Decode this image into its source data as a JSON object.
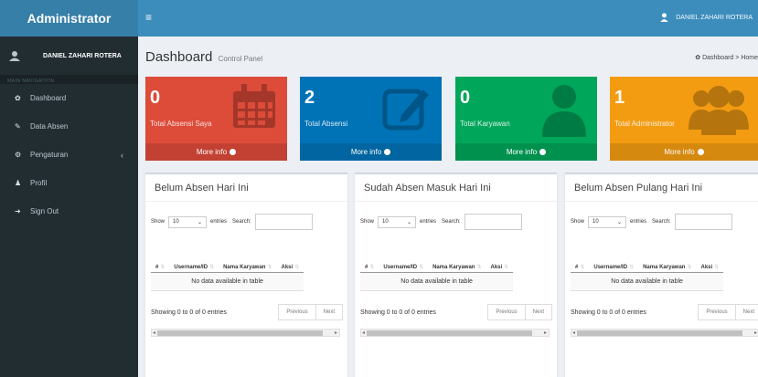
{
  "header": {
    "logo": "Administrator",
    "toggle_icon": "≡",
    "user_name": "DANIEL ZAHARI ROTERA"
  },
  "sidebar": {
    "user_name": "DANIEL ZAHARI ROTERA",
    "nav_header": "MAIN NAVIGATION",
    "items": [
      {
        "label": "Dashboard",
        "icon": "dashboard-icon",
        "glyph": "✿"
      },
      {
        "label": "Data Absen",
        "icon": "edit-icon",
        "glyph": "✎"
      },
      {
        "label": "Pengaturan",
        "icon": "gears-icon",
        "glyph": "⚙",
        "caret": "‹"
      },
      {
        "label": "Profil",
        "icon": "user-icon",
        "glyph": "♟"
      },
      {
        "label": "Sign Out",
        "icon": "sign-out-icon",
        "glyph": "➜"
      }
    ]
  },
  "page": {
    "title": "Dashboard",
    "subtitle": "Control Panel",
    "breadcrumb_home": "Dashboard",
    "breadcrumb_sep": ">",
    "breadcrumb_current": "Home"
  },
  "boxes": [
    {
      "value": "0",
      "label": "Total Absensi Saya",
      "footer": "More info",
      "color": "#dd4b39",
      "icon": "calendar-icon"
    },
    {
      "value": "2",
      "label": "Total Absensi",
      "footer": "More info",
      "color": "#0073b7",
      "icon": "edit-icon"
    },
    {
      "value": "0",
      "label": "Total Karyawan",
      "footer": "More info",
      "color": "#00a65a",
      "icon": "user-icon"
    },
    {
      "value": "1",
      "label": "Total Administrator",
      "footer": "More info",
      "color": "#f39c12",
      "icon": "users-icon"
    }
  ],
  "panels": [
    {
      "title": "Belum Absen Hari Ini",
      "show": "Show",
      "entries_value": "10",
      "entries": "entries",
      "search": "Search:",
      "columns": [
        "#",
        "Username/ID",
        "Nama Karyawan",
        "Aksi"
      ],
      "empty": "No data available in table",
      "info": "Showing 0 to 0 of 0 entries",
      "prev": "Previous",
      "next": "Next"
    },
    {
      "title": "Sudah Absen Masuk Hari Ini",
      "show": "Show",
      "entries_value": "10",
      "entries": "entries",
      "search": "Search:",
      "columns": [
        "#",
        "Username/ID",
        "Nama Karyawan",
        "Aksi"
      ],
      "empty": "No data available in table",
      "info": "Showing 0 to 0 of 0 entries",
      "prev": "Previous",
      "next": "Next"
    },
    {
      "title": "Belum Absen Pulang Hari Ini",
      "show": "Show",
      "entries_value": "10",
      "entries": "entries",
      "search": "Search:",
      "columns": [
        "#",
        "Username/ID",
        "Nama Karyawan",
        "Aksi"
      ],
      "empty": "No data available in table",
      "info": "Showing 0 to 0 of 0 entries",
      "prev": "Previous",
      "next": "Next"
    }
  ]
}
